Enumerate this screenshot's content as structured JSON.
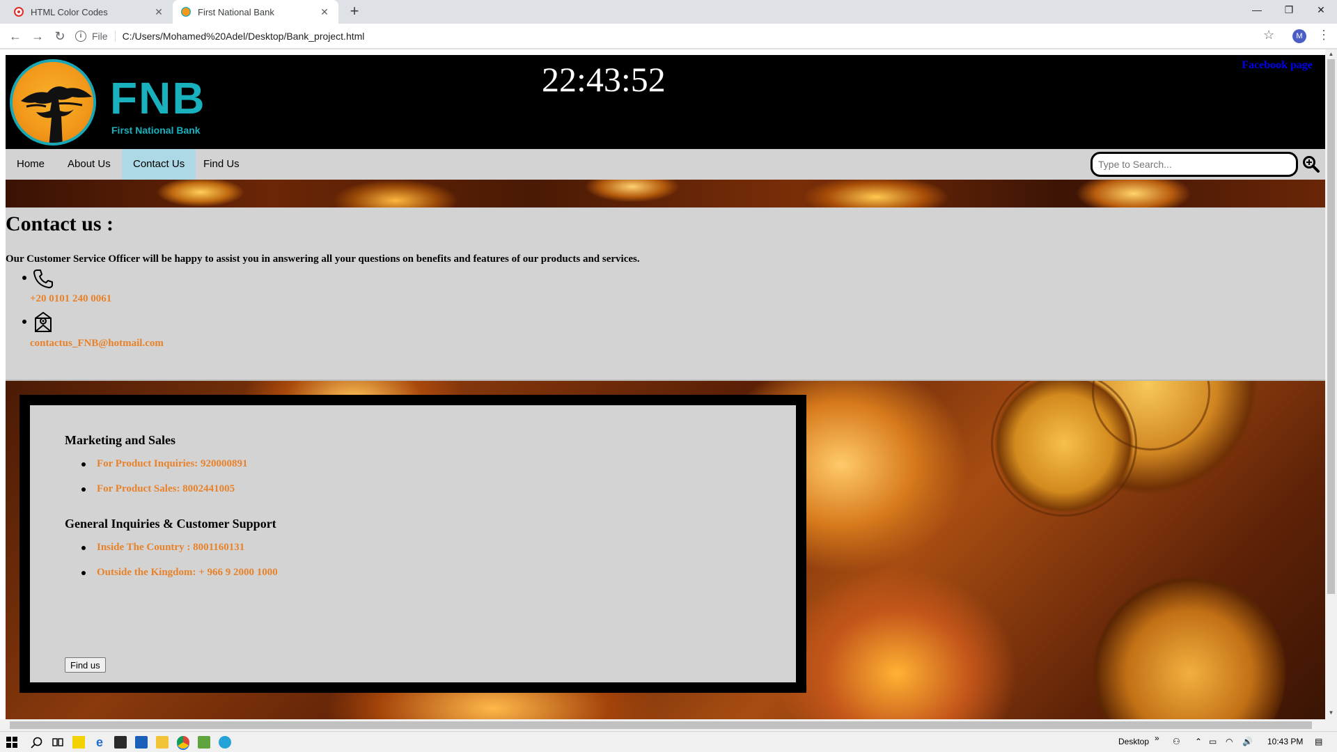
{
  "browser": {
    "tabs": [
      {
        "title": "HTML Color Codes",
        "active": false,
        "favicon_color": "#e0302a"
      },
      {
        "title": "First National Bank",
        "active": true,
        "favicon_color": "#1aa7b5"
      }
    ],
    "url_scheme": "File",
    "url": "C:/Users/Mohamed%20Adel/Desktop/Bank_project.html",
    "profile_initial": "M"
  },
  "header": {
    "logo_text": "FNB",
    "logo_subtitle": "First National Bank",
    "clock": "22:43:52",
    "facebook_link": "Facebook page"
  },
  "nav": {
    "items": [
      {
        "label": "Home",
        "active": false
      },
      {
        "label": "About Us",
        "active": false
      },
      {
        "label": "Contact Us",
        "active": true
      },
      {
        "label": "Find Us",
        "active": false
      }
    ],
    "search_placeholder": "Type to Search..."
  },
  "contact": {
    "title": "Contact us :",
    "description": "Our Customer Service Officer will be happy to assist you in answering all your questions on benefits and features of our products and services.",
    "phone": "+20 0101 240 0061",
    "email": "contactus_FNB@hotmail.com"
  },
  "support": {
    "marketing_title": "Marketing and Sales",
    "marketing_items": [
      "For Product Inquiries: 920000891",
      "For Product Sales: 8002441005"
    ],
    "general_title": "General Inquiries & Customer Support",
    "general_items": [
      "Inside The Country : 8001160131",
      "Outside the Kingdom: + 966 9 2000 1000"
    ],
    "button_label": "Find us"
  },
  "taskbar": {
    "desktop_label": "Desktop",
    "time": "10:43 PM"
  },
  "colors": {
    "accent_orange": "#e8822a",
    "brand_teal": "#19b1be",
    "active_nav": "#add8e6",
    "link_blue": "#0000ee"
  }
}
